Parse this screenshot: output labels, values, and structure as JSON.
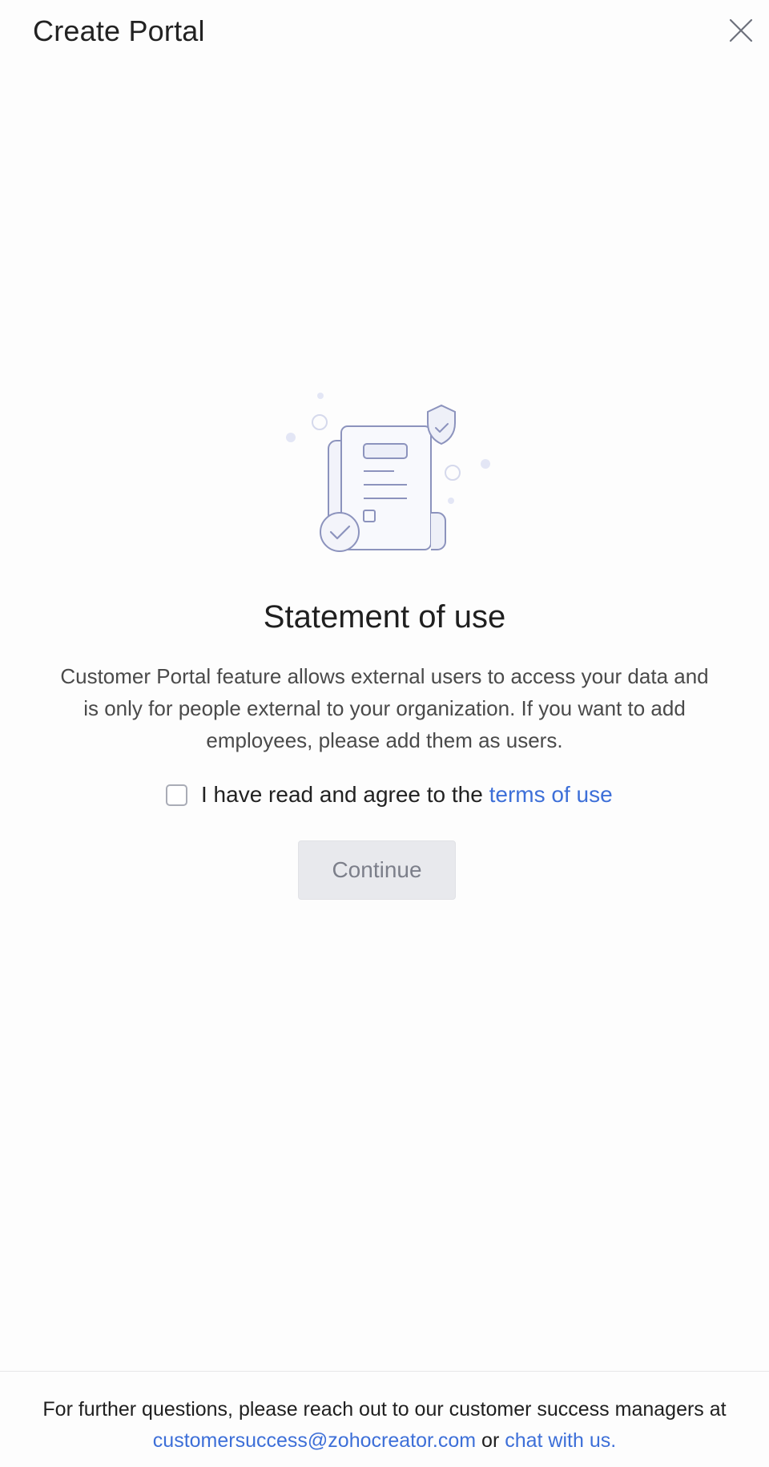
{
  "header": {
    "title": "Create Portal",
    "close_icon": "close-icon"
  },
  "illustration": {
    "icon": "document-shield-check-icon"
  },
  "main": {
    "heading": "Statement of use",
    "description": "Customer Portal feature allows external users to access your data and is only for people external to your organization. If you want to add employees, please add them as users.",
    "agree_checked": false,
    "agree_prefix": "I have read and agree to the ",
    "terms_link": "terms of use",
    "continue_label": "Continue"
  },
  "footer": {
    "line1": "For further questions, please reach out to our customer success managers at",
    "email_link": "customersuccess@zohocreator.com",
    "or_text": " or ",
    "chat_link": "chat with us."
  },
  "colors": {
    "link": "#3d6fd8",
    "button_disabled_bg": "#e8e9ed",
    "button_disabled_text": "#7c7f8a"
  }
}
